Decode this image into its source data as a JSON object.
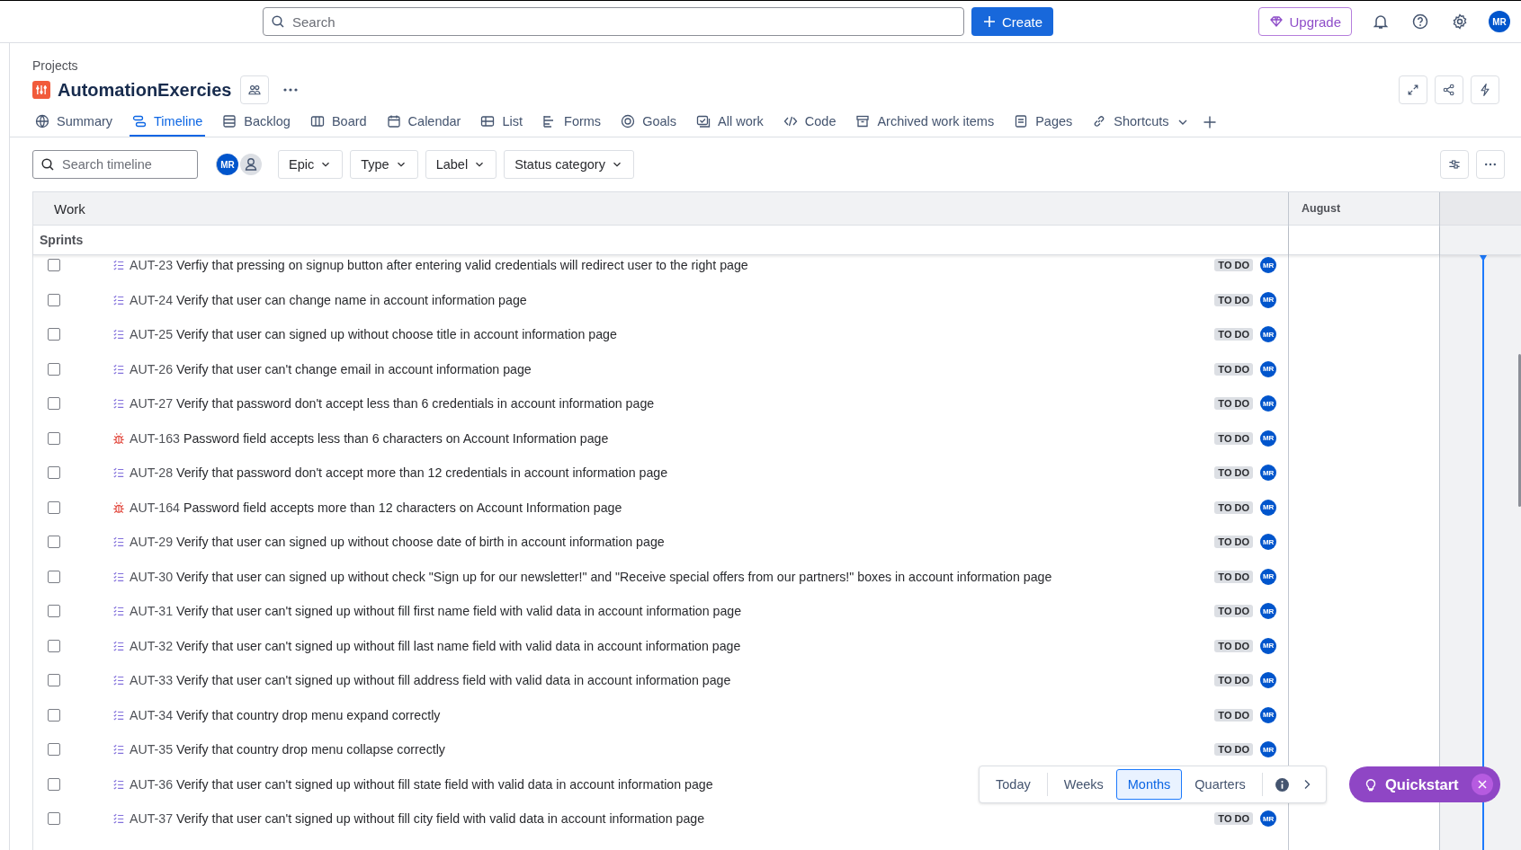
{
  "topbar": {
    "search_placeholder": "Search",
    "create": "Create",
    "upgrade": "Upgrade",
    "avatar": "MR"
  },
  "project": {
    "breadcrumb": "Projects",
    "name": "AutomationExercies"
  },
  "tabs": [
    {
      "label": "Summary",
      "selected": false
    },
    {
      "label": "Timeline",
      "selected": true
    },
    {
      "label": "Backlog",
      "selected": false
    },
    {
      "label": "Board",
      "selected": false
    },
    {
      "label": "Calendar",
      "selected": false
    },
    {
      "label": "List",
      "selected": false
    },
    {
      "label": "Forms",
      "selected": false
    },
    {
      "label": "Goals",
      "selected": false
    },
    {
      "label": "All work",
      "selected": false
    },
    {
      "label": "Code",
      "selected": false
    },
    {
      "label": "Archived work items",
      "selected": false
    },
    {
      "label": "Pages",
      "selected": false
    },
    {
      "label": "Shortcuts",
      "selected": false
    }
  ],
  "filters": {
    "search_placeholder": "Search timeline",
    "avatar": "MR",
    "dropdowns": [
      "Epic",
      "Type",
      "Label",
      "Status category"
    ]
  },
  "timeline": {
    "work_header": "Work",
    "month": "August",
    "group": "Sprints",
    "rows": [
      {
        "kind": "story",
        "key": "AUT-23",
        "summary": "Verfiy that pressing on signup button after entering valid credentials will redirect user to the right page",
        "status": "TO DO",
        "assignee": "MR",
        "checked": false
      },
      {
        "kind": "story",
        "key": "AUT-24",
        "summary": "Verify that user can change name in account information page",
        "status": "TO DO",
        "assignee": "MR",
        "checked": false
      },
      {
        "kind": "story",
        "key": "AUT-25",
        "summary": "Verify that user can signed up without choose title in account information page",
        "status": "TO DO",
        "assignee": "MR",
        "checked": false
      },
      {
        "kind": "story",
        "key": "AUT-26",
        "summary": "Verify that user can't change email in account information page",
        "status": "TO DO",
        "assignee": "MR",
        "checked": false
      },
      {
        "kind": "story",
        "key": "AUT-27",
        "summary": "Verify that password don't accept less than 6 credentials in account information page",
        "status": "TO DO",
        "assignee": "MR",
        "checked": false
      },
      {
        "kind": "bug",
        "key": "AUT-163",
        "summary": "Password field accepts less than 6 characters on Account Information page",
        "status": "TO DO",
        "assignee": "MR",
        "checked": false
      },
      {
        "kind": "story",
        "key": "AUT-28",
        "summary": "Verify that password don't accept more than 12 credentials in account information page",
        "status": "TO DO",
        "assignee": "MR",
        "checked": false
      },
      {
        "kind": "bug",
        "key": "AUT-164",
        "summary": "Password field accepts more than 12 characters on Account Information page",
        "status": "TO DO",
        "assignee": "MR",
        "checked": false
      },
      {
        "kind": "story",
        "key": "AUT-29",
        "summary": "Verify that user can signed up without choose date of birth in account information page",
        "status": "TO DO",
        "assignee": "MR",
        "checked": false
      },
      {
        "kind": "story",
        "key": "AUT-30",
        "summary": "Verify that user can signed up without check \"Sign up for our newsletter!\" and \"Receive special offers from our partners!\" boxes in account information page",
        "status": "TO DO",
        "assignee": "MR",
        "checked": false
      },
      {
        "kind": "story",
        "key": "AUT-31",
        "summary": "Verify that user can't signed up without fill first name field with valid data in account information page",
        "status": "TO DO",
        "assignee": "MR",
        "checked": false
      },
      {
        "kind": "story",
        "key": "AUT-32",
        "summary": "Verify that user can't signed up without fill last name field with valid data in account information page",
        "status": "TO DO",
        "assignee": "MR",
        "checked": false
      },
      {
        "kind": "story",
        "key": "AUT-33",
        "summary": "Verify that user can't signed up without fill address field with valid data in account information page",
        "status": "TO DO",
        "assignee": "MR",
        "checked": false
      },
      {
        "kind": "story",
        "key": "AUT-34",
        "summary": "Verify that country drop menu expand correctly",
        "status": "TO DO",
        "assignee": "MR",
        "checked": false
      },
      {
        "kind": "story",
        "key": "AUT-35",
        "summary": "Verify that country drop menu collapse correctly",
        "status": "TO DO",
        "assignee": "MR",
        "checked": false
      },
      {
        "kind": "story",
        "key": "AUT-36",
        "summary": "Verify that user can't signed up without fill state field with valid data in account information page",
        "checked": false
      },
      {
        "kind": "story",
        "key": "AUT-37",
        "summary": "Verify that user can't signed up without fill city field with valid data in account information page",
        "status": "TO DO",
        "assignee": "MR",
        "checked": false
      }
    ]
  },
  "view_switcher": {
    "options": [
      {
        "label": "Today",
        "selected": false
      },
      {
        "label": "Weeks",
        "selected": false
      },
      {
        "label": "Months",
        "selected": true
      },
      {
        "label": "Quarters",
        "selected": false
      }
    ]
  },
  "quickstart": {
    "label": "Quickstart"
  }
}
